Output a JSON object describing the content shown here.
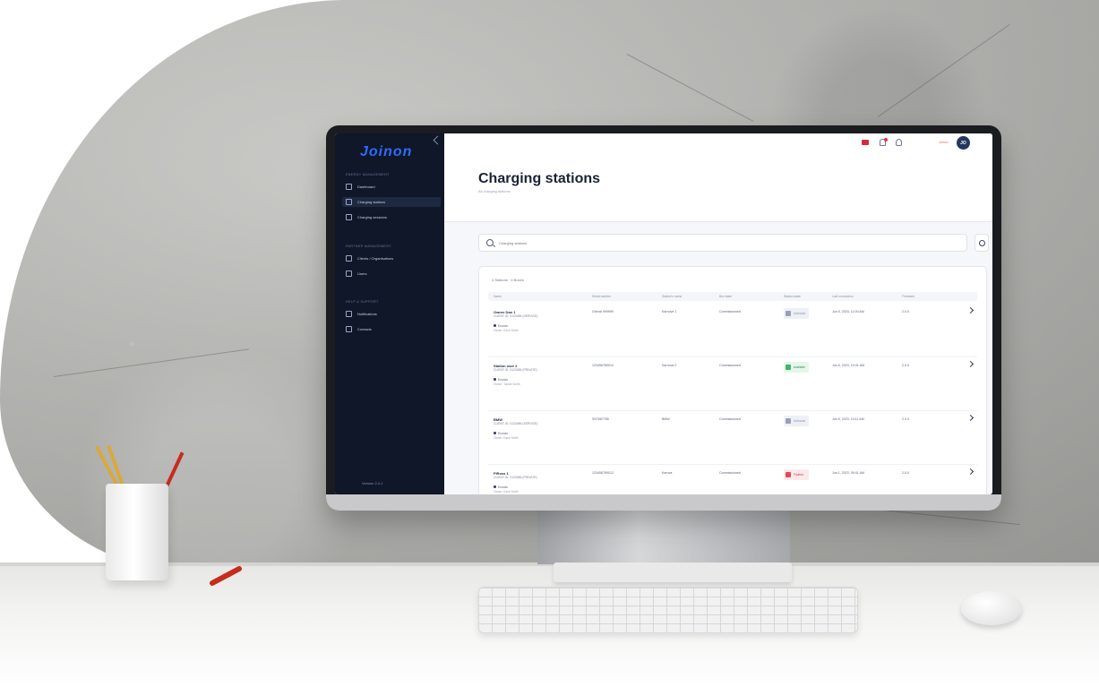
{
  "app": {
    "logo_text": "Joinon",
    "version": "Version 2.4.1"
  },
  "sidebar": {
    "section1_title": "ENERGY MANAGEMENT",
    "section2_title": "PARTNER MANAGEMENT",
    "items": [
      {
        "label": "Dashboard",
        "icon": "monitor-icon",
        "active": false
      },
      {
        "label": "Charging stations",
        "icon": "charging-station-icon",
        "active": true
      },
      {
        "label": "Charging sessions",
        "icon": "plug-icon",
        "active": false
      },
      {
        "label": "Clients / Organisations",
        "icon": "building-icon",
        "active": false
      },
      {
        "label": "Users",
        "icon": "users-icon",
        "active": false
      },
      {
        "label": "Notifications",
        "icon": "bell-icon",
        "active": false
      },
      {
        "label": "Contacts",
        "icon": "contacts-icon",
        "active": false
      }
    ],
    "section3_title": "HELP & SUPPORT"
  },
  "topbar": {
    "user_label": "Joinon"
  },
  "header": {
    "title": "Charging stations",
    "subtitle": "All charging stations"
  },
  "search": {
    "placeholder": "Charging stations"
  },
  "table": {
    "count_label": "4 Stations · 4 Boxes",
    "columns": [
      "Name",
      "Serial number",
      "Station's name",
      "Box state",
      "Station state",
      "Last connection",
      "Firmware"
    ],
    "rows": [
      {
        "name": "Owner Dan 1",
        "sub": "CLIENT ID: 0123456 (SERVICE)",
        "brand": "Ecosto",
        "brand_sub": "Owner: Dave Smith",
        "serial": "Gheral 999999",
        "station_name": "Karnove 1",
        "box_state": "Commissioned",
        "station_state": "Unknown",
        "status_color": "#eef0f5",
        "status_square": "#9aa0b4",
        "last_connection": "Jun 5, 2023, 11:00 AM",
        "firmware": "2.0.0"
      },
      {
        "name": "Station user 2",
        "sub": "CLIENT ID: 0123456 (PRIVATE)",
        "brand": "Ecosto",
        "brand_sub": "Owner: Tomas Smith",
        "serial": "123456789012",
        "station_name": "Karnova 2",
        "box_state": "Commissioned",
        "station_state": "Available",
        "status_color": "#e6f6ea",
        "status_square": "#3fb36b",
        "last_connection": "Jun 6, 2023, 10:41 AM",
        "firmware": "2.0.0"
      },
      {
        "name": "BMW",
        "sub": "CLIENT ID: 0123456 (SERVICE)",
        "brand": "Ecosto",
        "brand_sub": "Owner: Dave Smith",
        "serial": "SS7687785",
        "station_name": "BMW",
        "box_state": "Commissioned",
        "station_state": "Unknown",
        "status_color": "#eef0f5",
        "status_square": "#9aa0b4",
        "last_connection": "Jun 6, 2023, 10:11 AM",
        "firmware": "2.0.0"
      },
      {
        "name": "FiRoss 1",
        "sub": "CLIENT ID: 0123456 (PRIVATE)",
        "brand": "Ecosto",
        "brand_sub": "Owner: Dave Smith",
        "serial": "123456789012",
        "station_name": "Karnva",
        "box_state": "Commissioned",
        "station_state": "Faulted",
        "status_color": "#fde8ea",
        "status_square": "#e2475c",
        "last_connection": "Jun 1, 2023, 09:41 AM",
        "firmware": "2.0.0"
      }
    ]
  },
  "colors": {
    "sidebar_bg": "#0f1728",
    "accent": "#2f6bff",
    "avatar_bg": "#233760"
  }
}
